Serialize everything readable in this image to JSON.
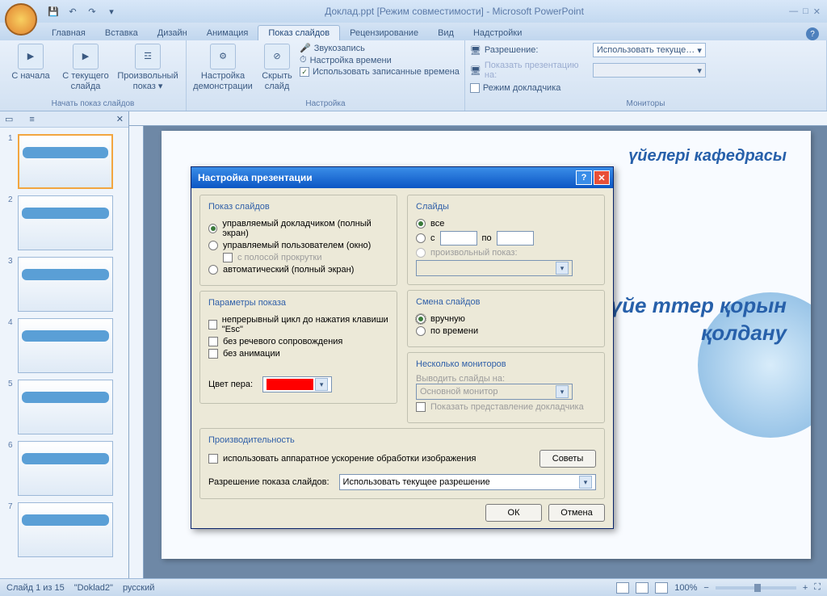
{
  "title": "Доклад.ppt [Режим совместимости] - Microsoft PowerPoint",
  "tabs": {
    "home": "Главная",
    "insert": "Вставка",
    "design": "Дизайн",
    "animation": "Анимация",
    "slideshow": "Показ слайдов",
    "review": "Рецензирование",
    "view": "Вид",
    "addins": "Надстройки"
  },
  "ribbon": {
    "from_start": "С начала",
    "from_current": "С текущего слайда",
    "custom_show": "Произвольный показ ▾",
    "group_start": "Начать показ слайдов",
    "setup_show": "Настройка демонстрации",
    "hide_slide": "Скрыть слайд",
    "record_narr": "Звукозапись",
    "rehearse": "Настройка времени",
    "use_timings_chk": "Использовать записанные времена",
    "group_setup": "Настройка",
    "resolution_lbl": "Разрешение:",
    "resolution_val": "Использовать текуще…",
    "show_on_lbl": "Показать презентацию на:",
    "presenter_chk": "Режим докладчика",
    "group_monitors": "Мониторы"
  },
  "thumbs": {
    "tab_slides_icon": "☰",
    "tab_outline_icon": "≡"
  },
  "slide": {
    "header_right": "үйелері кафедрасы",
    "body": "лған жүйе ттер қорын қолдану"
  },
  "dialog": {
    "title": "Настройка презентации",
    "group_show": "Показ слайдов",
    "r_presenter_full": "управляемый докладчиком (полный экран)",
    "r_user_window": "управляемый пользователем (окно)",
    "c_scrollbar": "с полосой прокрутки",
    "r_auto_full": "автоматический (полный экран)",
    "group_opts": "Параметры показа",
    "c_loop_esc": "непрерывный цикл до нажатия клавиши \"Esc\"",
    "c_no_narr": "без речевого сопровождения",
    "c_no_anim": "без анимации",
    "pen_color": "Цвет пера:",
    "group_slides": "Слайды",
    "r_all": "все",
    "r_from": "с",
    "r_to": "по",
    "r_custom": "произвольный показ:",
    "group_advance": "Смена слайдов",
    "r_manual": "вручную",
    "r_by_time": "по времени",
    "group_multi": "Несколько мониторов",
    "show_on": "Выводить слайды на:",
    "primary_mon": "Основной монитор",
    "c_presenter_view": "Показать представление докладчика",
    "group_perf": "Производительность",
    "c_hw_accel": "использовать аппаратное ускорение обработки изображения",
    "btn_tips": "Советы",
    "res_lbl": "Разрешение показа слайдов:",
    "res_val": "Использовать текущее разрешение",
    "ok": "ОК",
    "cancel": "Отмена"
  },
  "status": {
    "slide": "Слайд 1 из 15",
    "theme": "\"Doklad2\"",
    "lang": "русский",
    "zoom": "100%"
  }
}
